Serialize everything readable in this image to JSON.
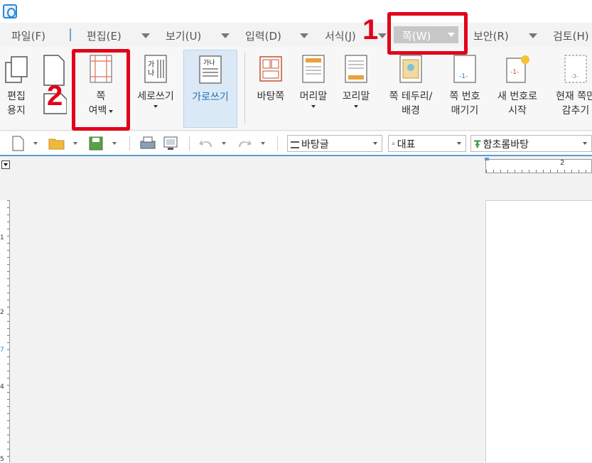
{
  "menu": {
    "items": [
      {
        "label": "파일(F)"
      },
      {
        "label": "편집(E)"
      },
      {
        "label": "보기(U)"
      },
      {
        "label": "입력(D)"
      },
      {
        "label": "서식(J)"
      },
      {
        "label": "쪽(W)"
      },
      {
        "label": "보안(R)"
      },
      {
        "label": "검토(H)"
      }
    ],
    "active": "쪽(W)"
  },
  "annotations": {
    "step1": "1",
    "step2": "2",
    "color": "#e2001a"
  },
  "ribbon": {
    "buttons": [
      {
        "label": "편집\n용지",
        "icon": "edit-paper-icon"
      },
      {
        "label": "",
        "icon": "page-orientation-icon"
      },
      {
        "label": "쪽\n여백",
        "icon": "page-margin-icon",
        "dropdown": true
      },
      {
        "label": "세로쓰기",
        "icon": "vertical-writing-icon",
        "dropdown": true
      },
      {
        "label": "가로쓰기",
        "icon": "horizontal-writing-icon"
      },
      {
        "label": "바탕쪽",
        "icon": "master-page-icon"
      },
      {
        "label": "머리말",
        "icon": "header-icon",
        "dropdown": true
      },
      {
        "label": "꼬리말",
        "icon": "footer-icon",
        "dropdown": true
      },
      {
        "label": "쪽 테두리/\n배경",
        "icon": "page-border-icon"
      },
      {
        "label": "쪽 번호\n매기기",
        "icon": "page-number-icon"
      },
      {
        "label": "새 번호로\n시작",
        "icon": "new-number-icon"
      },
      {
        "label": "현재 쪽만\n감추기",
        "icon": "hide-current-page-icon"
      }
    ]
  },
  "toolbar": {
    "style_combo": "바탕글",
    "lang_combo": "대표",
    "font_combo": "함초롬바탕"
  },
  "ruler": {
    "h_label": "2",
    "v_labels": [
      "1",
      "2",
      "7",
      "4",
      "5"
    ]
  },
  "colors": {
    "accent": "#5b9bd5",
    "annotation": "#e2001a",
    "active_menu": "#c7c7c7"
  }
}
